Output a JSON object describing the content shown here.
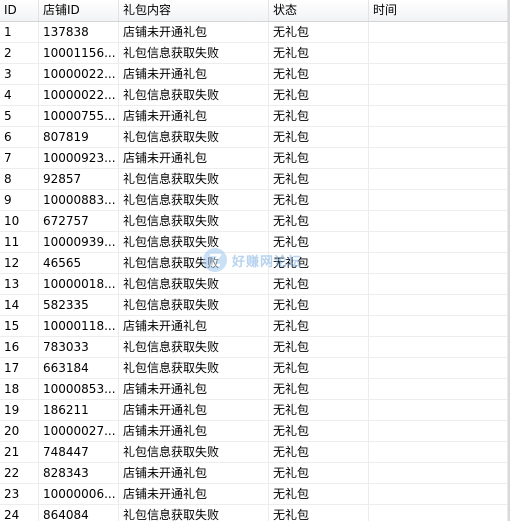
{
  "columns": {
    "id": "ID",
    "shop_id": "店铺ID",
    "gift_content": "礼包内容",
    "status": "状态",
    "time": "时间"
  },
  "rows": [
    {
      "id": "1",
      "shop_id": "137838",
      "gift_content": "店铺未开通礼包",
      "status": "无礼包",
      "time": ""
    },
    {
      "id": "2",
      "shop_id": "10001156...",
      "gift_content": "礼包信息获取失败",
      "status": "无礼包",
      "time": ""
    },
    {
      "id": "3",
      "shop_id": "10000022...",
      "gift_content": "店铺未开通礼包",
      "status": "无礼包",
      "time": ""
    },
    {
      "id": "4",
      "shop_id": "10000022...",
      "gift_content": "礼包信息获取失败",
      "status": "无礼包",
      "time": ""
    },
    {
      "id": "5",
      "shop_id": "10000755...",
      "gift_content": "店铺未开通礼包",
      "status": "无礼包",
      "time": ""
    },
    {
      "id": "6",
      "shop_id": "807819",
      "gift_content": "礼包信息获取失败",
      "status": "无礼包",
      "time": ""
    },
    {
      "id": "7",
      "shop_id": "10000923...",
      "gift_content": "店铺未开通礼包",
      "status": "无礼包",
      "time": ""
    },
    {
      "id": "8",
      "shop_id": "92857",
      "gift_content": "礼包信息获取失败",
      "status": "无礼包",
      "time": ""
    },
    {
      "id": "9",
      "shop_id": "10000883...",
      "gift_content": "礼包信息获取失败",
      "status": "无礼包",
      "time": ""
    },
    {
      "id": "10",
      "shop_id": "672757",
      "gift_content": "礼包信息获取失败",
      "status": "无礼包",
      "time": ""
    },
    {
      "id": "11",
      "shop_id": "10000939...",
      "gift_content": "礼包信息获取失败",
      "status": "无礼包",
      "time": ""
    },
    {
      "id": "12",
      "shop_id": "46565",
      "gift_content": "礼包信息获取失败",
      "status": "无礼包",
      "time": ""
    },
    {
      "id": "13",
      "shop_id": "10000018...",
      "gift_content": "礼包信息获取失败",
      "status": "无礼包",
      "time": ""
    },
    {
      "id": "14",
      "shop_id": "582335",
      "gift_content": "礼包信息获取失败",
      "status": "无礼包",
      "time": ""
    },
    {
      "id": "15",
      "shop_id": "10000118...",
      "gift_content": "店铺未开通礼包",
      "status": "无礼包",
      "time": ""
    },
    {
      "id": "16",
      "shop_id": "783033",
      "gift_content": "礼包信息获取失败",
      "status": "无礼包",
      "time": ""
    },
    {
      "id": "17",
      "shop_id": "663184",
      "gift_content": "礼包信息获取失败",
      "status": "无礼包",
      "time": ""
    },
    {
      "id": "18",
      "shop_id": "10000853...",
      "gift_content": "店铺未开通礼包",
      "status": "无礼包",
      "time": ""
    },
    {
      "id": "19",
      "shop_id": "186211",
      "gift_content": "店铺未开通礼包",
      "status": "无礼包",
      "time": ""
    },
    {
      "id": "20",
      "shop_id": "10000027...",
      "gift_content": "店铺未开通礼包",
      "status": "无礼包",
      "time": ""
    },
    {
      "id": "21",
      "shop_id": "748447",
      "gift_content": "礼包信息获取失败",
      "status": "无礼包",
      "time": ""
    },
    {
      "id": "22",
      "shop_id": "828343",
      "gift_content": "店铺未开通礼包",
      "status": "无礼包",
      "time": ""
    },
    {
      "id": "23",
      "shop_id": "10000006...",
      "gift_content": "店铺未开通礼包",
      "status": "无礼包",
      "time": ""
    },
    {
      "id": "24",
      "shop_id": "864084",
      "gift_content": "礼包信息获取失败",
      "status": "无礼包",
      "time": ""
    }
  ],
  "watermark": {
    "text": "好赚网论坛",
    "icon": "z-logo-icon"
  }
}
